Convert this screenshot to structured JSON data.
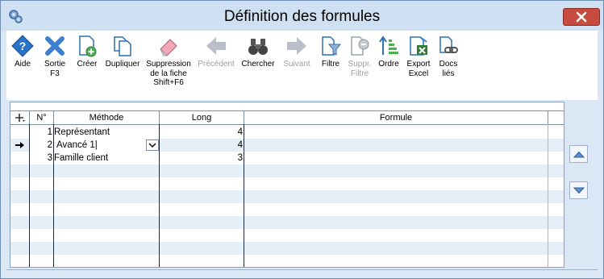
{
  "window": {
    "title": "Définition des formules"
  },
  "toolbar": [
    {
      "id": "aide",
      "lines": [
        "Aide"
      ],
      "disabled": false,
      "icon": "help-icon"
    },
    {
      "id": "sortie",
      "lines": [
        "Sortie",
        "F3"
      ],
      "disabled": false,
      "icon": "exit-x-icon"
    },
    {
      "id": "creer",
      "lines": [
        "Créer"
      ],
      "disabled": false,
      "icon": "create-document-icon"
    },
    {
      "id": "dupliquer",
      "lines": [
        "Dupliquer"
      ],
      "disabled": false,
      "icon": "duplicate-icon"
    },
    {
      "id": "suppression",
      "lines": [
        "Suppression",
        "de la fiche",
        "Shift+F6"
      ],
      "disabled": false,
      "icon": "eraser-icon"
    },
    {
      "id": "precedent",
      "lines": [
        "Précédent"
      ],
      "disabled": true,
      "icon": "arrow-left-icon"
    },
    {
      "id": "chercher",
      "lines": [
        "Chercher"
      ],
      "disabled": false,
      "icon": "binoculars-icon"
    },
    {
      "id": "suivant",
      "lines": [
        "Suivant"
      ],
      "disabled": true,
      "icon": "arrow-right-icon"
    },
    {
      "id": "filtre",
      "lines": [
        "Filtre"
      ],
      "disabled": false,
      "icon": "filter-icon"
    },
    {
      "id": "suppr_filtre",
      "lines": [
        "Suppr.",
        "Filtre"
      ],
      "disabled": true,
      "icon": "remove-filter-icon"
    },
    {
      "id": "ordre",
      "lines": [
        "Ordre"
      ],
      "disabled": false,
      "icon": "sort-order-icon"
    },
    {
      "id": "export_excel",
      "lines": [
        "Export",
        "Excel"
      ],
      "disabled": false,
      "icon": "excel-export-icon"
    },
    {
      "id": "docs_lies",
      "lines": [
        "Docs",
        "liés"
      ],
      "disabled": false,
      "icon": "linked-docs-icon"
    }
  ],
  "grid": {
    "columns": {
      "no": "N°",
      "methode": "Méthode",
      "long": "Long",
      "formule": "Formule"
    },
    "rows": [
      {
        "no": "1",
        "methode": "Représentant",
        "long": "4",
        "formule": ""
      },
      {
        "no": "2",
        "methode": "Avancé 1",
        "long": "4",
        "formule": ""
      },
      {
        "no": "3",
        "methode": "Famille client",
        "long": "3",
        "formule": ""
      }
    ],
    "current_row": 2,
    "empty_rows": 8
  },
  "colors": {
    "window_bg": "#dbe7f4",
    "alt_row": "#e6eef8",
    "close": "#c74b3e"
  }
}
